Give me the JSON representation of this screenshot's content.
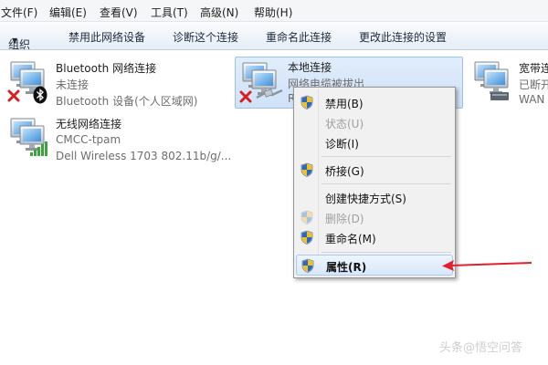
{
  "menubar": {
    "items": [
      "文件(F)",
      "编辑(E)",
      "查看(V)",
      "工具(T)",
      "高级(N)",
      "帮助(H)"
    ]
  },
  "commandbar": {
    "organize": "组织",
    "items": [
      "禁用此网络设备",
      "诊断这个连接",
      "重命名此连接",
      "更改此连接的设置"
    ]
  },
  "connections": [
    {
      "name": "Bluetooth 网络连接",
      "status": "未连接",
      "device": "Bluetooth 设备(个人区域网)"
    },
    {
      "name": "本地连接",
      "status": "网络电缆被拔出",
      "device": "R"
    },
    {
      "name": "宽带连",
      "status": "已断开",
      "device": "WAN"
    },
    {
      "name": "无线网络连接",
      "status": "CMCC-tpam",
      "device": "Dell Wireless 1703 802.11b/g/..."
    }
  ],
  "context_menu": {
    "items": [
      {
        "label": "禁用(B)",
        "icon": "shield-icon",
        "disabled": false
      },
      {
        "label": "状态(U)",
        "disabled": true
      },
      {
        "label": "诊断(I)",
        "disabled": false
      },
      {
        "label": "桥接(G)",
        "icon": "shield-icon",
        "disabled": false
      },
      {
        "label": "创建快捷方式(S)",
        "disabled": false
      },
      {
        "label": "删除(D)",
        "icon": "shield-icon",
        "disabled": true
      },
      {
        "label": "重命名(M)",
        "icon": "shield-icon",
        "disabled": false
      },
      {
        "label": "属性(R)",
        "icon": "shield-icon",
        "disabled": false,
        "highlighted": true
      }
    ]
  },
  "annotation": {
    "arrow_color": "#e0212e"
  },
  "watermark": "头条@悟空问答"
}
